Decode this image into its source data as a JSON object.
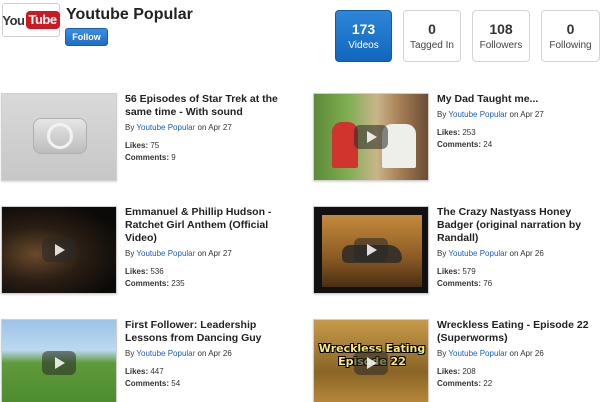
{
  "header": {
    "logo": {
      "you": "You",
      "tube": "Tube"
    },
    "channel_title": "Youtube Popular",
    "follow_label": "Follow"
  },
  "stats": [
    {
      "count": "173",
      "label": "Videos",
      "active": true
    },
    {
      "count": "0",
      "label": "Tagged In",
      "active": false
    },
    {
      "count": "108",
      "label": "Followers",
      "active": false
    },
    {
      "count": "0",
      "label": "Following",
      "active": false
    }
  ],
  "videos": [
    {
      "title": "56 Episodes of Star Trek at the same time - With sound",
      "by": "By",
      "author": "Youtube Popular",
      "date": "on Apr 27",
      "likes_label": "Likes:",
      "likes": "75",
      "comments_label": "Comments:",
      "comments": "9",
      "thumb": "placeholder"
    },
    {
      "title": "My Dad Taught me...",
      "by": "By",
      "author": "Youtube Popular",
      "date": "on Apr 27",
      "likes_label": "Likes:",
      "likes": "253",
      "comments_label": "Comments:",
      "comments": "24",
      "thumb": "two-men"
    },
    {
      "title": "Emmanuel & Phillip Hudson - Ratchet Girl Anthem (Official Video)",
      "by": "By",
      "author": "Youtube Popular",
      "date": "on Apr 27",
      "likes_label": "Likes:",
      "likes": "536",
      "comments_label": "Comments:",
      "comments": "235",
      "thumb": "dark-scene"
    },
    {
      "title": "The Crazy Nastyass Honey Badger (original narration by Randall)",
      "by": "By",
      "author": "Youtube Popular",
      "date": "on Apr 26",
      "likes_label": "Likes:",
      "likes": "579",
      "comments_label": "Comments:",
      "comments": "76",
      "thumb": "honey-badger"
    },
    {
      "title": "First Follower: Leadership Lessons from Dancing Guy",
      "by": "By",
      "author": "Youtube Popular",
      "date": "on Apr 26",
      "likes_label": "Likes:",
      "likes": "447",
      "comments_label": "Comments:",
      "comments": "54",
      "thumb": "hillside-dance"
    },
    {
      "title": "Wreckless Eating - Episode 22 (Superworms)",
      "by": "By",
      "author": "Youtube Popular",
      "date": "on Apr 26",
      "likes_label": "Likes:",
      "likes": "208",
      "comments_label": "Comments:",
      "comments": "22",
      "thumb": "superworms",
      "thumb_caption_1": "Wreckless Eating",
      "thumb_caption_2": "Episode 22"
    }
  ],
  "colors": {
    "accent": "#1f6cc4",
    "link": "#1a5ec4",
    "logo_red": "#cc181e"
  }
}
